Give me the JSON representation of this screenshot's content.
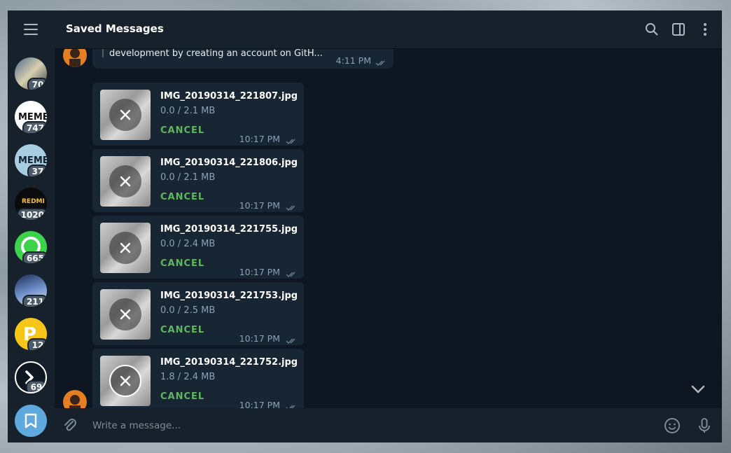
{
  "header": {
    "title": "Saved Messages"
  },
  "sidebar": {
    "chats": [
      {
        "badge": "70"
      },
      {
        "badge": "747"
      },
      {
        "badge": "37"
      },
      {
        "badge": "1020"
      },
      {
        "badge": "665"
      },
      {
        "badge": "211"
      },
      {
        "badge": "12"
      },
      {
        "badge": "69"
      }
    ]
  },
  "previous_message": {
    "text": "development by creating an account on GitH...",
    "time": "4:11 PM"
  },
  "files": [
    {
      "name": "IMG_20190314_221807.jpg",
      "size": "0.0 / 2.1 MB",
      "action": "CANCEL",
      "time": "10:17 PM"
    },
    {
      "name": "IMG_20190314_221806.jpg",
      "size": "0.0 / 2.1 MB",
      "action": "CANCEL",
      "time": "10:17 PM"
    },
    {
      "name": "IMG_20190314_221755.jpg",
      "size": "0.0 / 2.4 MB",
      "action": "CANCEL",
      "time": "10:17 PM"
    },
    {
      "name": "IMG_20190314_221753.jpg",
      "size": "0.0 / 2.5 MB",
      "action": "CANCEL",
      "time": "10:17 PM"
    },
    {
      "name": "IMG_20190314_221752.jpg",
      "size": "1.8 / 2.4 MB",
      "action": "CANCEL",
      "time": "10:17 PM"
    }
  ],
  "compose": {
    "placeholder": "Write a message..."
  },
  "colors": {
    "accent": "#5ea9dd",
    "cancel": "#5fb85f",
    "badge": "#4d5c6b"
  }
}
